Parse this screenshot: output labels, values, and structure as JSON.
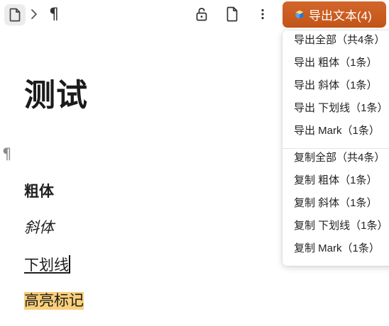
{
  "toolbar": {
    "pilcrow": "¶",
    "export_button_label": "导出文本(4)",
    "export_button_color": "#c7581e",
    "icons": [
      "file-icon",
      "chevron-right-icon",
      "pilcrow-icon",
      "lock-open-icon",
      "file-icon",
      "more-vertical-icon",
      "cube-icon"
    ]
  },
  "export_menu": {
    "export_items": [
      "导出全部（共4条）",
      "导出 粗体（1条）",
      "导出 斜体（1条）",
      "导出 下划线（1条）",
      "导出 Mark（1条）"
    ],
    "copy_items": [
      "复制全部（共4条）",
      "复制 粗体（1条）",
      "复制 斜体（1条）",
      "复制 下划线（1条）",
      "复制 Mark（1条）"
    ]
  },
  "document": {
    "title": "测试",
    "empty_paragraph_marker": "¶",
    "bold_text": "粗体",
    "italic_text": "斜体",
    "underline_text": "下划线",
    "mark_text": "高亮标记",
    "highlight_color": "#f9cf7a"
  }
}
